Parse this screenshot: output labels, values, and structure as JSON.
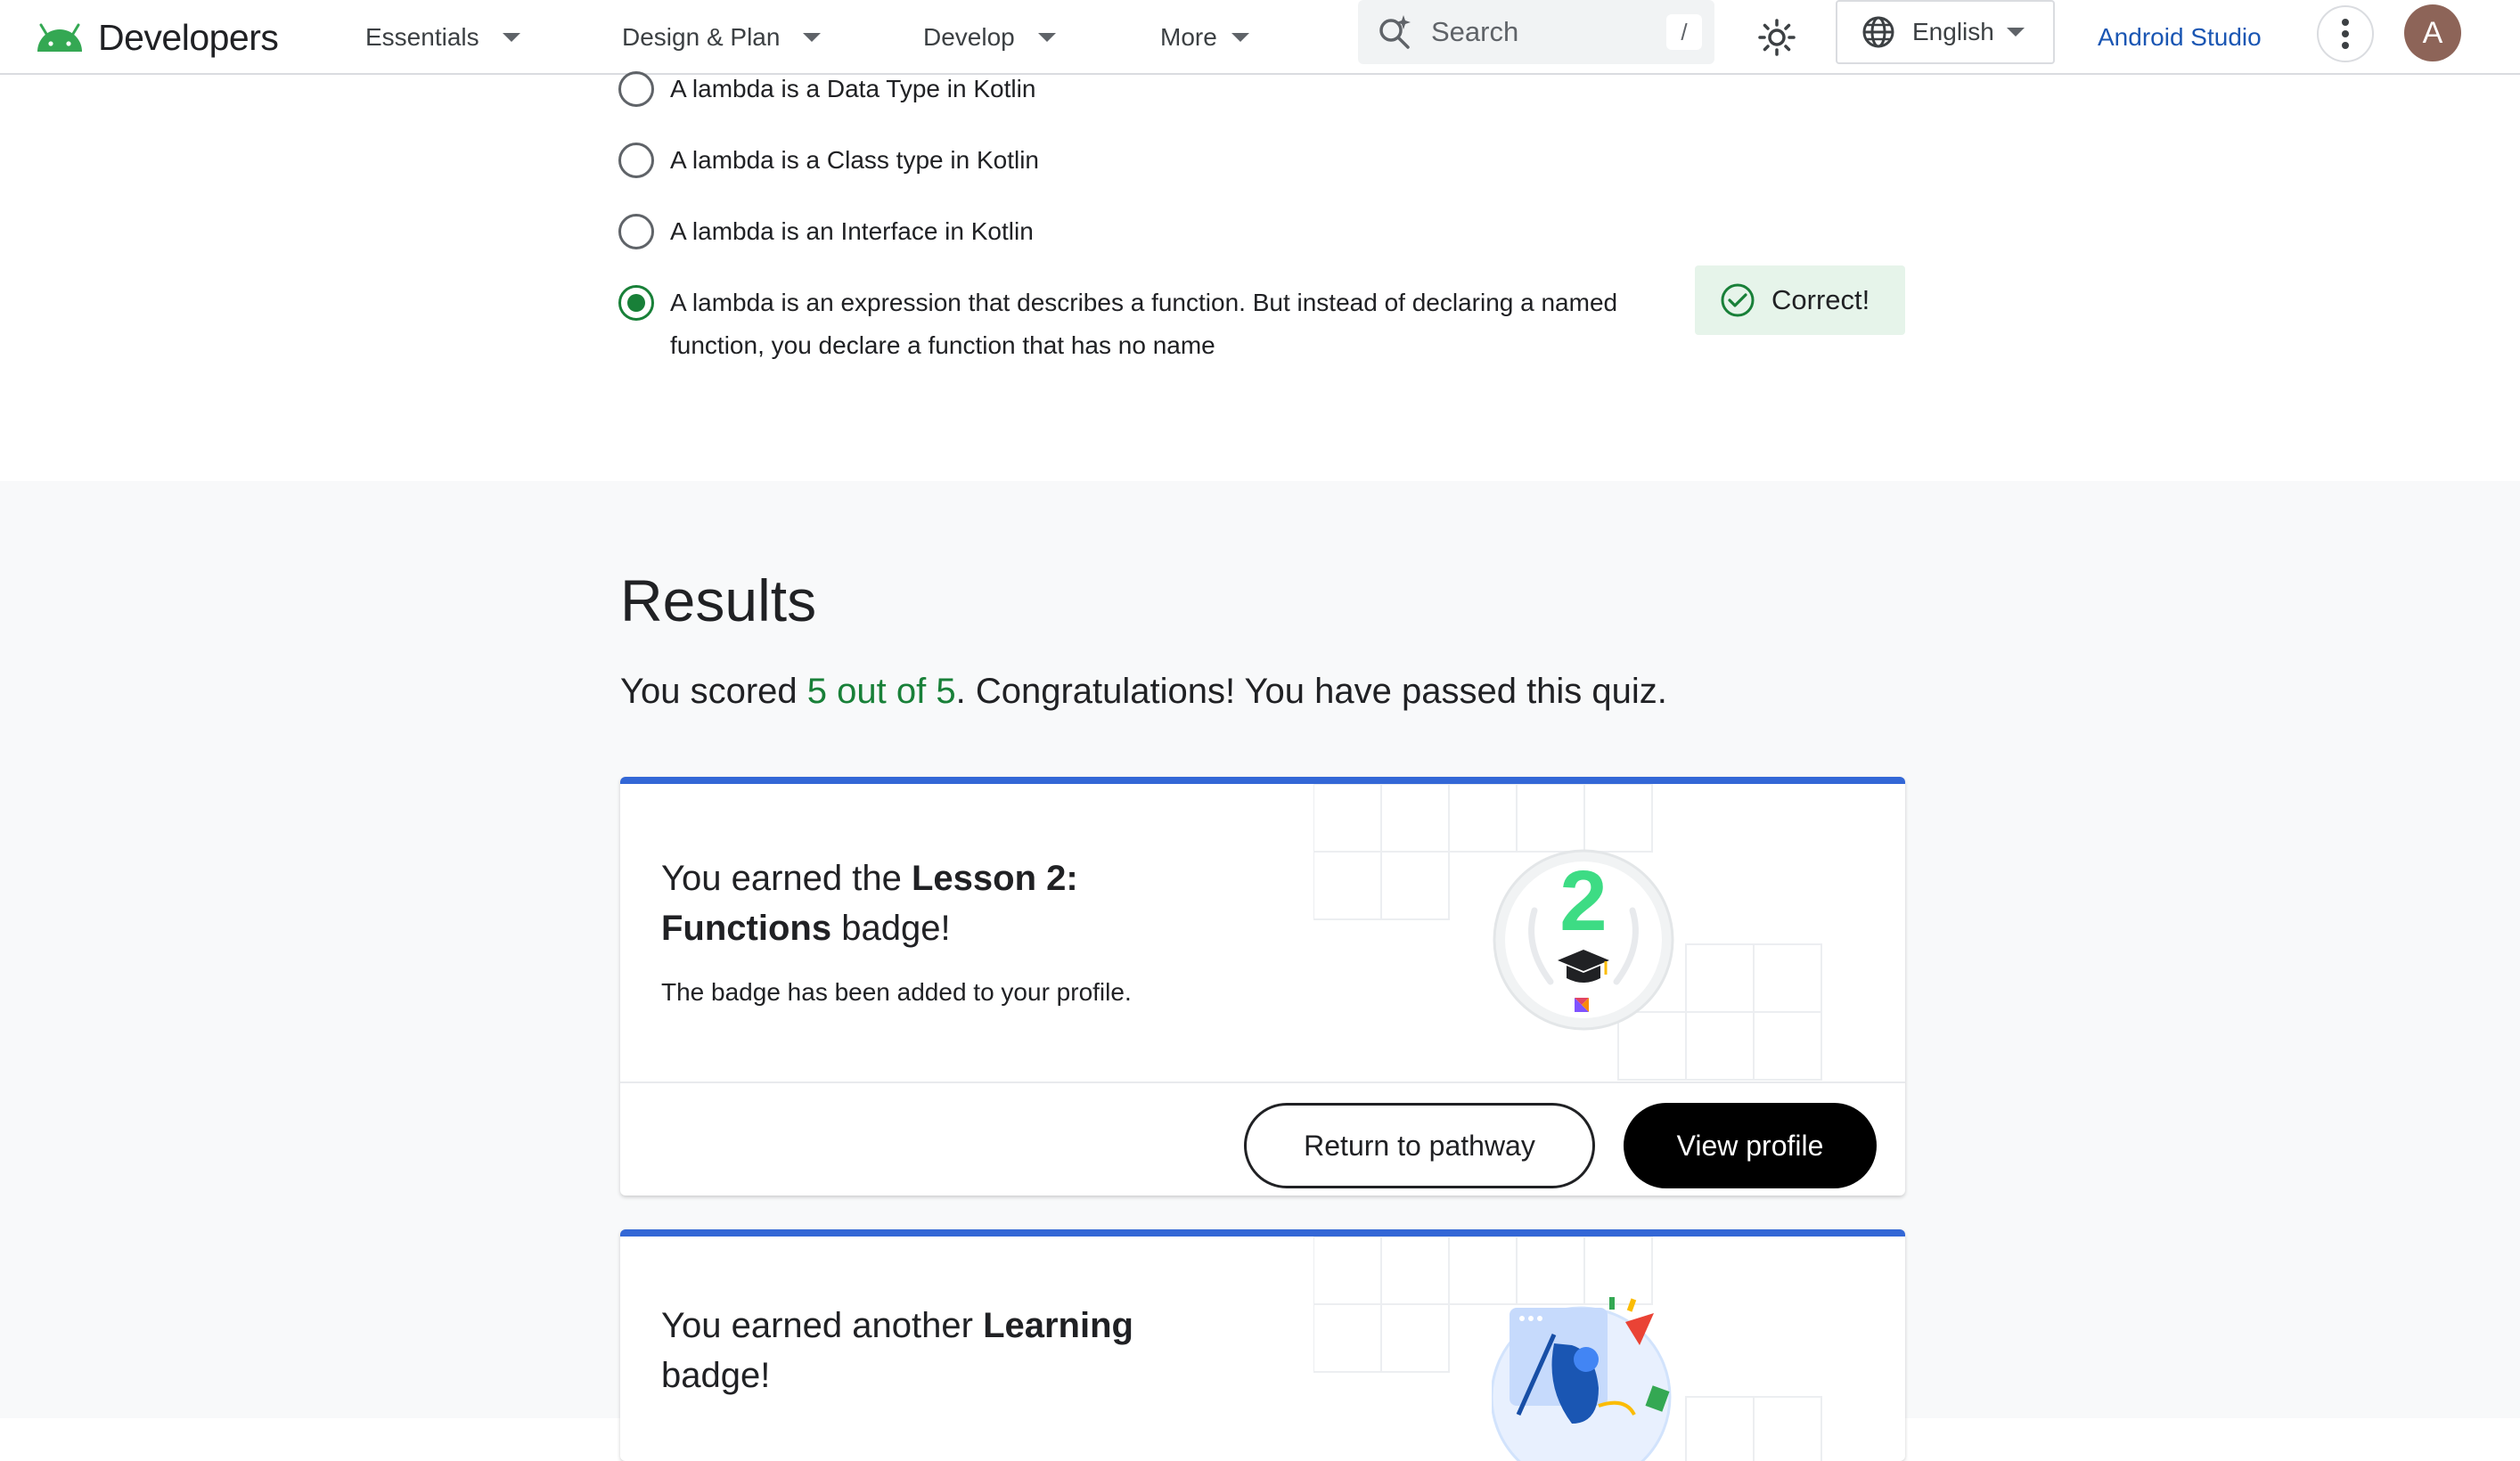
{
  "header": {
    "brand": "Developers",
    "nav": [
      {
        "label": "Essentials"
      },
      {
        "label": "Design & Plan"
      },
      {
        "label": "Develop"
      },
      {
        "label": "More"
      }
    ],
    "search": {
      "placeholder": "Search",
      "shortcut": "/"
    },
    "language": "English",
    "studio_link": "Android Studio",
    "avatar_initial": "A"
  },
  "quiz": {
    "options": [
      {
        "label": "A lambda is a Data Type in Kotlin",
        "selected": false
      },
      {
        "label": "A lambda is a Class type in Kotlin",
        "selected": false
      },
      {
        "label": "A lambda is an Interface in Kotlin",
        "selected": false
      },
      {
        "label_line1": "A lambda is an expression that describes a function. But instead of declaring a named",
        "label_line2": "function, you declare a function that has no name",
        "selected": true
      }
    ],
    "feedback": "Correct!"
  },
  "results": {
    "title": "Results",
    "score_prefix": "You scored ",
    "score_value": "5 out of 5",
    "score_suffix": ". Congratulations! You have passed this quiz."
  },
  "badge_card": {
    "title_prefix": "You earned the ",
    "title_bold_1": "Lesson 2:",
    "title_bold_2": "Functions",
    "title_suffix": " badge!",
    "subtitle": "The badge has been added to your profile.",
    "badge_number": "2",
    "return_button": "Return to pathway",
    "profile_button": "View profile"
  },
  "learning_card": {
    "title_prefix": "You earned another ",
    "title_bold": "Learning",
    "title_suffix": "badge!"
  },
  "colors": {
    "accent_blue": "#3367d6",
    "success_green": "#188038",
    "success_bg": "#e6f4ea",
    "link_blue": "#1a56b3"
  }
}
